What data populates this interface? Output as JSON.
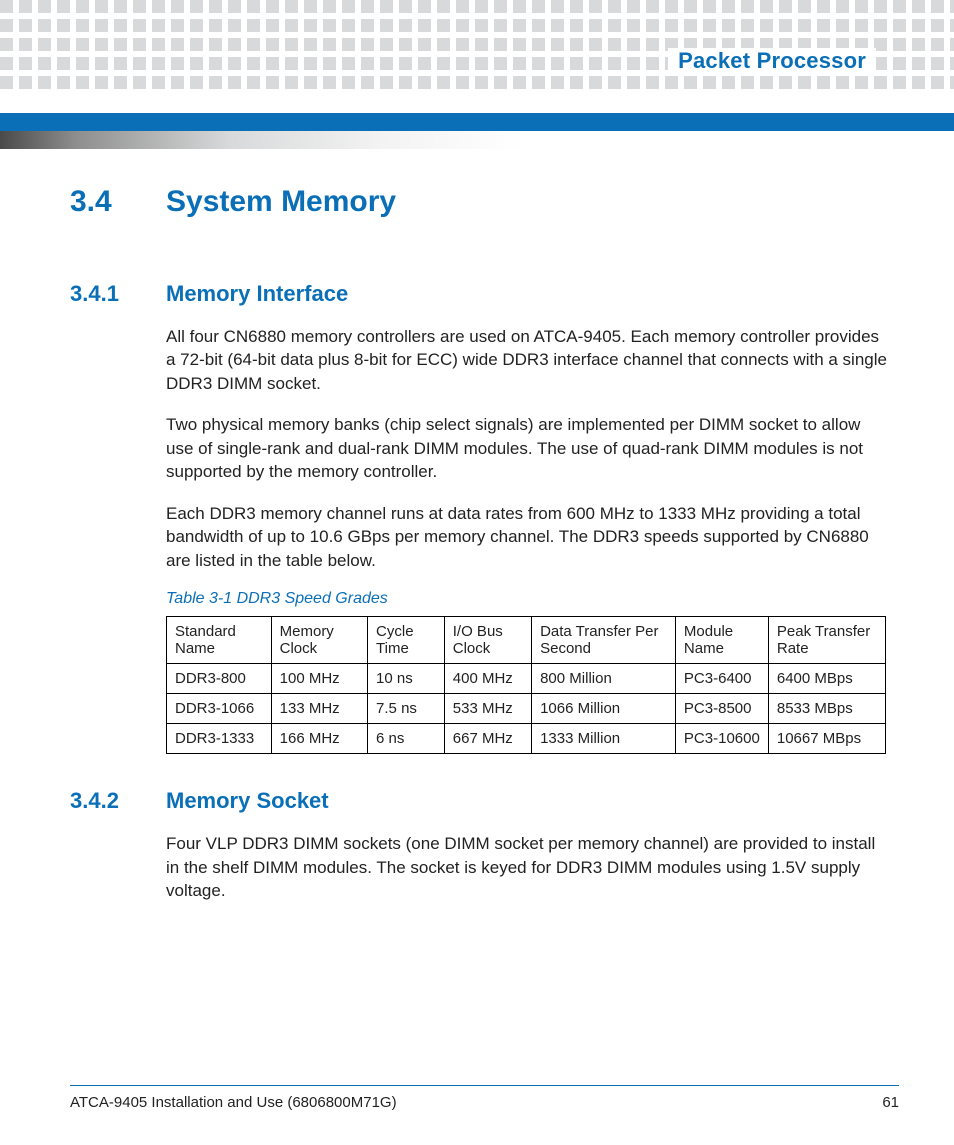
{
  "header": {
    "chapter": "Packet Processor"
  },
  "section": {
    "number": "3.4",
    "title": "System Memory"
  },
  "sub1": {
    "number": "3.4.1",
    "title": "Memory Interface",
    "p1": "All four CN6880 memory controllers are used on ATCA-9405. Each memory controller provides a 72-bit (64-bit data plus 8-bit for ECC) wide DDR3 interface channel that connects with a single DDR3 DIMM socket.",
    "p2": "Two physical memory banks (chip select signals) are implemented per DIMM socket to allow use of single-rank and dual-rank DIMM modules. The use of quad-rank DIMM modules is not supported by the memory controller.",
    "p3": "Each DDR3 memory channel runs at data rates from 600 MHz to 1333 MHz providing a total bandwidth of up to 10.6 GBps per memory channel. The DDR3 speeds supported by CN6880 are listed in the table below."
  },
  "table": {
    "caption": "Table 3-1 DDR3 Speed Grades",
    "headers": [
      "Standard Name",
      "Memory Clock",
      "Cycle Time",
      "I/O Bus Clock",
      "Data Transfer Per Second",
      "Module Name",
      "Peak Transfer Rate"
    ],
    "rows": [
      [
        "DDR3-800",
        "100 MHz",
        "10 ns",
        "400 MHz",
        "800 Million",
        "PC3-6400",
        "6400 MBps"
      ],
      [
        "DDR3-1066",
        "133 MHz",
        "7.5 ns",
        "533 MHz",
        "1066 Million",
        "PC3-8500",
        "8533 MBps"
      ],
      [
        "DDR3-1333",
        "166 MHz",
        "6 ns",
        "667 MHz",
        "1333 Million",
        "PC3-10600",
        "10667 MBps"
      ]
    ]
  },
  "sub2": {
    "number": "3.4.2",
    "title": "Memory Socket",
    "p1": "Four VLP DDR3 DIMM sockets (one DIMM socket per memory channel) are provided to install in the shelf DIMM modules. The socket is keyed for DDR3 DIMM modules using 1.5V supply voltage."
  },
  "footer": {
    "left": "ATCA-9405 Installation and Use (6806800M71G)",
    "right": "61"
  }
}
